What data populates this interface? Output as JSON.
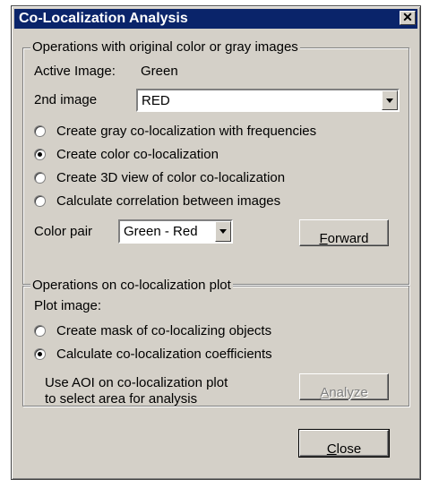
{
  "window": {
    "title": "Co-Localization Analysis",
    "close_glyph": "✕"
  },
  "group1": {
    "label": "Operations with original color or gray images",
    "active_image_label": "Active Image:",
    "active_image_value": "Green",
    "second_image_label": "2nd image",
    "second_image_value": "RED",
    "options": [
      {
        "label": "Create gray co-localization with frequencies",
        "checked": false
      },
      {
        "label": "Create color co-localization",
        "checked": true
      },
      {
        "label": "Create 3D view of color co-localization",
        "checked": false
      },
      {
        "label": "Calculate correlation between images",
        "checked": false
      }
    ],
    "color_pair_label": "Color pair",
    "color_pair_value": "Green - Red",
    "forward_button": {
      "mnemonic": "F",
      "rest": "orward"
    }
  },
  "group2": {
    "label": "Operations on co-localization plot",
    "plot_image_label": "Plot image:",
    "options": [
      {
        "label": "Create mask of co-localizing objects",
        "checked": false
      },
      {
        "label": "Calculate co-localization coefficients",
        "checked": true
      }
    ],
    "aoi_hint_line1": "Use AOI on co-localization plot",
    "aoi_hint_line2": "to select area for analysis",
    "analyze_button": {
      "mnemonic": "A",
      "rest": "nalyze",
      "enabled": false
    }
  },
  "close_button": {
    "mnemonic": "C",
    "rest": "lose"
  }
}
